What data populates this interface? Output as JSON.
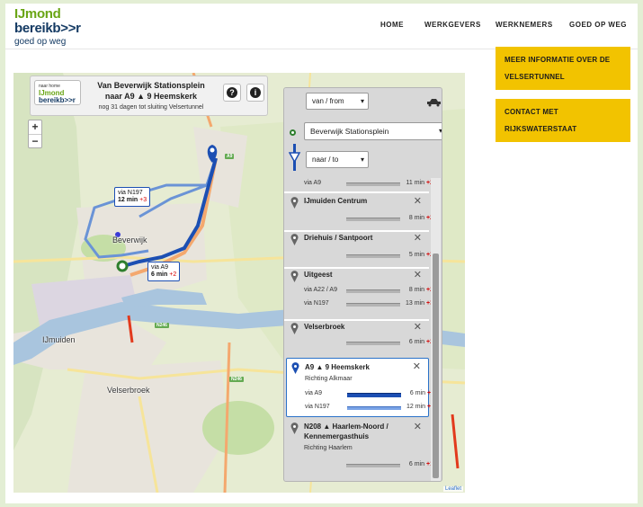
{
  "logo": {
    "line1": "IJmond",
    "line2": "bereikb>>r",
    "tagline": "goed op weg"
  },
  "nav": [
    "HOME",
    "WERKGEVERS",
    "WERKNEMERS",
    "GOED OP WEG"
  ],
  "side_buttons": [
    {
      "label": "MEER INFORMATIE OVER DE VELSERTUNNEL"
    },
    {
      "label": "CONTACT MET RIJKSWATERSTAAT"
    }
  ],
  "info_box": {
    "home_small": "naar home",
    "home_logo1": "IJmond",
    "home_logo2": "bereikb>>r",
    "title_line1": "Van Beverwijk Stationsplein",
    "title_line2": "naar A9 ▲ 9 Heemskerk",
    "subtitle": "nog 31 dagen tot sluiting Velsertunnel",
    "help_icon": "?",
    "info_icon": "i"
  },
  "map": {
    "zoom_in": "+",
    "zoom_out": "−",
    "places": [
      "Beverwijk",
      "IJmuiden",
      "Velserbroek"
    ],
    "shields": [
      "A9",
      "N246",
      "N246"
    ],
    "tip1": {
      "via": "via N197",
      "min": "12 min",
      "delay": "+3"
    },
    "tip2": {
      "via": "via A9",
      "min": "6 min",
      "delay": "+2"
    },
    "attribution": "Leaflet"
  },
  "panel": {
    "direction_from": "van / from",
    "from_value": "Beverwijk Stationsplein",
    "direction_to": "naar / to",
    "first_row": {
      "via": "via A9",
      "min": "11 min",
      "delay": "+2"
    },
    "items": [
      {
        "title": "IJmuiden Centrum",
        "rows": [
          {
            "via": "",
            "min": "8 min",
            "delay": "+2"
          }
        ]
      },
      {
        "title": "Driehuis / Santpoort",
        "rows": [
          {
            "via": "",
            "min": "5 min",
            "delay": "+2"
          }
        ]
      },
      {
        "title": "Uitgeest",
        "rows": [
          {
            "via": "via A22 / A9",
            "min": "8 min",
            "delay": "+2"
          },
          {
            "via": "via N197",
            "min": "13 min",
            "delay": "+3"
          }
        ]
      },
      {
        "title": "Velserbroek",
        "rows": [
          {
            "via": "",
            "min": "6 min",
            "delay": "+2"
          }
        ]
      },
      {
        "title": "A9 ▲ 9 Heemskerk",
        "sub": "Richting Alkmaar",
        "rows": [
          {
            "via": "via A9",
            "min": "6 min",
            "delay": "+2"
          },
          {
            "via": "via N197",
            "min": "12 min",
            "delay": "+3"
          }
        ]
      },
      {
        "title": "N208 ▲ Haarlem-Noord /",
        "title2": "Kennemergasthuis",
        "sub": "Richting Haarlem",
        "rows": [
          {
            "via": "",
            "min": "6 min",
            "delay": "+1"
          }
        ]
      }
    ]
  },
  "colors": {
    "accent_yellow": "#f2c300",
    "route_blue": "#1c4fb3",
    "delay_red": "#d40000",
    "logo_green": "#6aa515",
    "logo_navy": "#143a63"
  }
}
